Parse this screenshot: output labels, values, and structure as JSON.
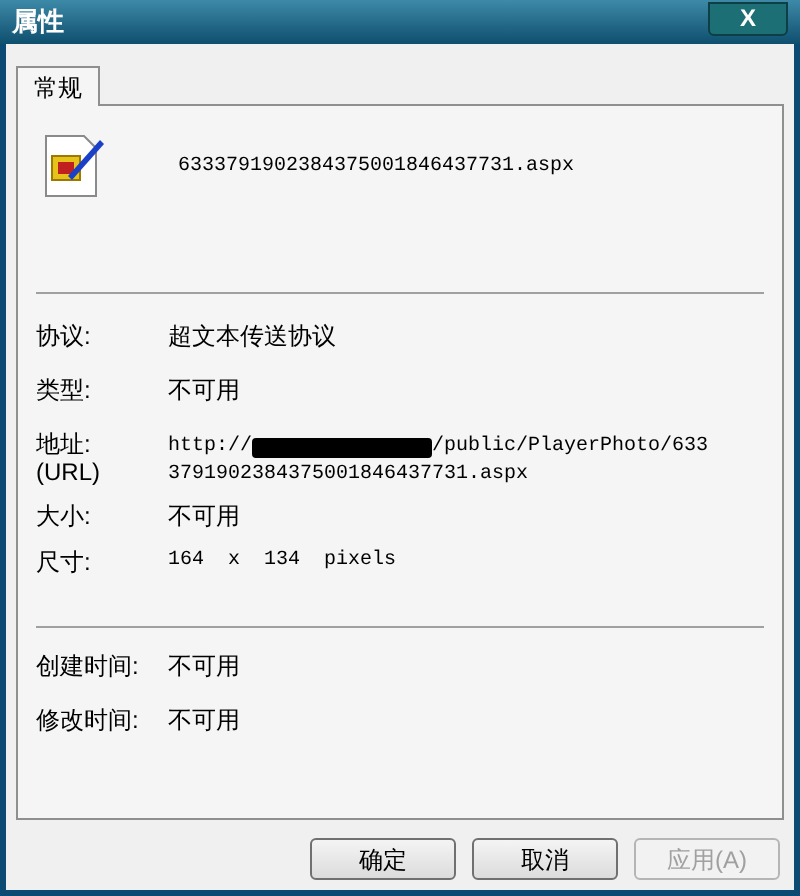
{
  "window": {
    "title": "属性",
    "close": "X"
  },
  "tabs": [
    {
      "label": "常规",
      "selected": true
    }
  ],
  "file_name": "6333791902384375001846437731.aspx",
  "properties": [
    {
      "label": "协议:",
      "value": "超文本传送协议",
      "kind": "text"
    },
    {
      "label": "类型:",
      "value": "不可用",
      "kind": "text"
    },
    {
      "label": "地址:",
      "sublabel": "(URL)",
      "kind": "url",
      "value_start": "http://",
      "value_after_redaction": "/public/PlayerPhoto/633",
      "value_line_2": "3791902384375001846437731.aspx"
    },
    {
      "label": "大小:",
      "value": "不可用",
      "kind": "text"
    },
    {
      "label": "尺寸:",
      "value": "164  x  134  pixels",
      "kind": "mono"
    }
  ],
  "dates": [
    {
      "label": "创建时间:",
      "value": "不可用"
    },
    {
      "label": "修改时间:",
      "value": "不可用"
    }
  ],
  "buttons": [
    {
      "label": "确定",
      "disabled": false
    },
    {
      "label": "取消",
      "disabled": false
    },
    {
      "label": "应用(A)",
      "disabled": true
    }
  ]
}
